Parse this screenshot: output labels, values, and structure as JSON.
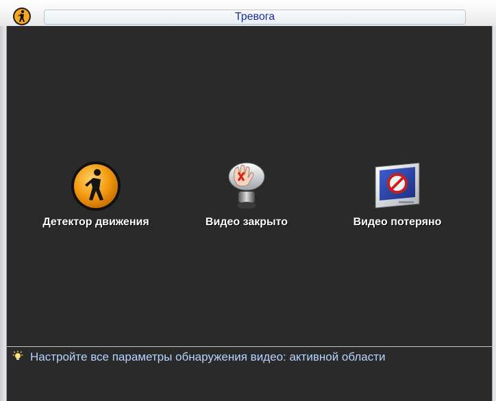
{
  "window": {
    "title": "Тревога",
    "title_icon": "motion-person-icon"
  },
  "menu": {
    "items": [
      {
        "label": "Детектор движения",
        "icon": "motion-detection-icon"
      },
      {
        "label": "Видео закрыто",
        "icon": "camera-masking-icon"
      },
      {
        "label": "Видео потеряно",
        "icon": "video-loss-icon"
      }
    ]
  },
  "hint": {
    "icon": "lightbulb-icon",
    "text": "Настройте все параметры обнаружения видео: активной области"
  },
  "colors": {
    "background": "#2a2a2a",
    "title_text": "#1a2a9a",
    "hint_text": "#b7d3ff",
    "accent_orange": "#f39c12"
  }
}
